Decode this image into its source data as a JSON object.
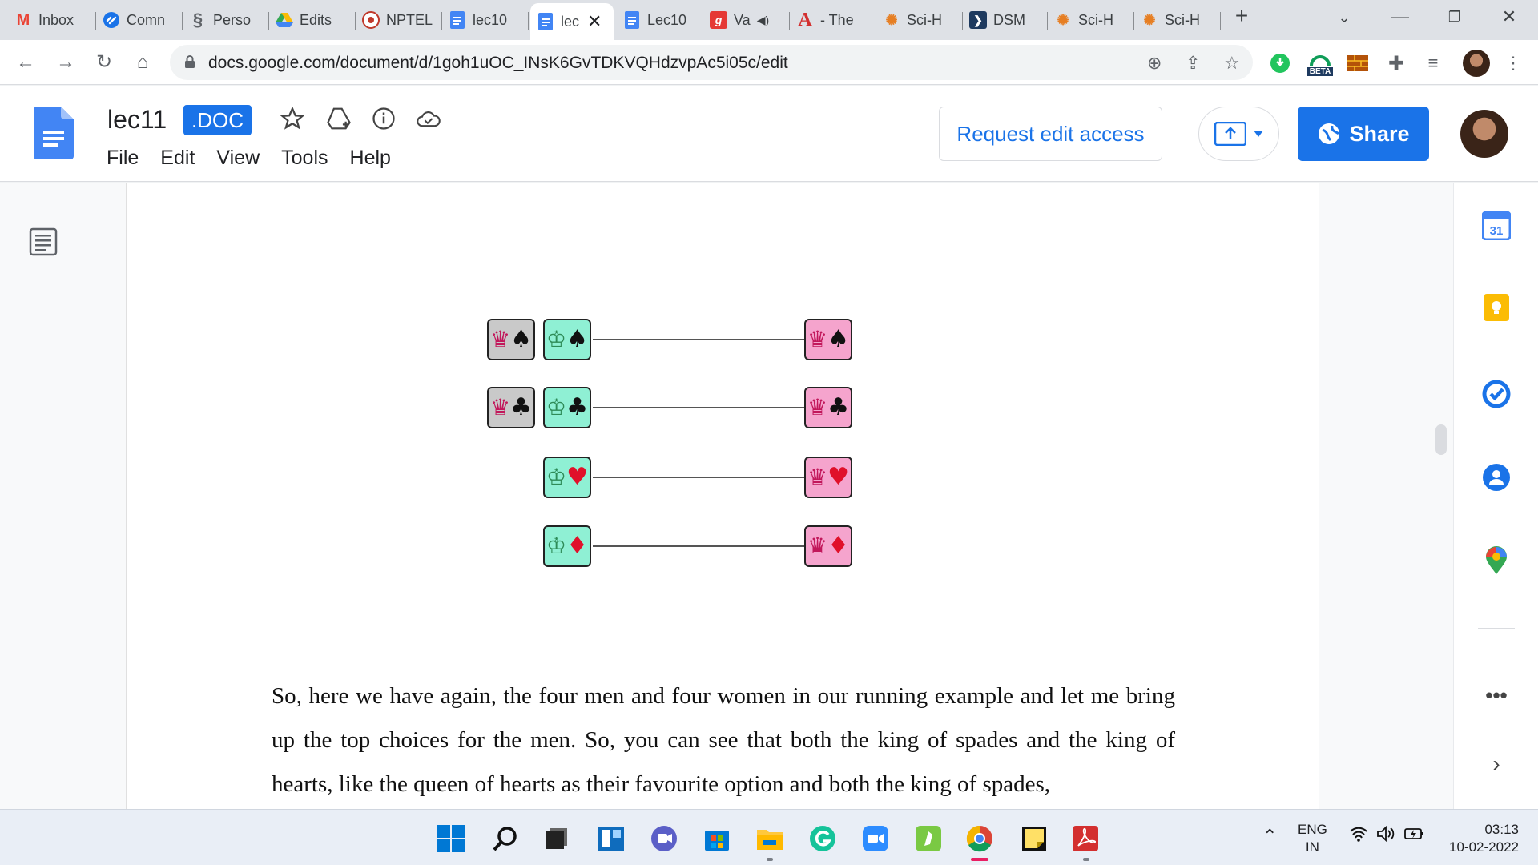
{
  "browser": {
    "tabs": [
      {
        "label": "Inbox",
        "icon": "gmail-icon",
        "color": "#ea4335"
      },
      {
        "label": "Comn",
        "icon": "link-icon",
        "color": "#1a73e8"
      },
      {
        "label": "Perso",
        "icon": "dna-icon",
        "color": "#5f6368"
      },
      {
        "label": "Edits",
        "icon": "drive-icon",
        "color": "#fbbc04"
      },
      {
        "label": "NPTEL",
        "icon": "nptel-icon",
        "color": "#c0392b"
      },
      {
        "label": "lec10",
        "icon": "docs-icon",
        "color": "#4285f4"
      },
      {
        "label": "lec",
        "icon": "docs-icon",
        "color": "#4285f4"
      },
      {
        "label": "Lec10",
        "icon": "docs-icon",
        "color": "#4285f4"
      },
      {
        "label": "Va",
        "icon": "g-icon",
        "color": "#e53935"
      },
      {
        "label": "- The",
        "icon": "acrobat-icon",
        "color": "#d32f2f"
      },
      {
        "label": "Sci-H",
        "icon": "scihub-icon",
        "color": "#e67e22"
      },
      {
        "label": "DSM",
        "icon": "arrow-icon",
        "color": "#1e3a5f"
      },
      {
        "label": "Sci-H",
        "icon": "scihub-icon",
        "color": "#e67e22"
      },
      {
        "label": "Sci-H",
        "icon": "scihub-icon",
        "color": "#e67e22"
      }
    ],
    "url": "docs.google.com/document/d/1goh1uOC_INsK6GvTDKVQHdzvpAc5i05c/edit",
    "beta_label": "BETA"
  },
  "doc": {
    "title": "lec11",
    "badge": ".DOC",
    "menu": [
      "File",
      "Edit",
      "View",
      "Tools",
      "Help"
    ],
    "request_edit": "Request edit access",
    "share": "Share"
  },
  "diagram": {
    "rows": [
      {
        "left_queen": "♠",
        "king": "♠",
        "right_queen": "♠",
        "suit_color": "black"
      },
      {
        "left_queen": "♣",
        "king": "♣",
        "right_queen": "♣",
        "suit_color": "black"
      },
      {
        "left_queen": "",
        "king": "♥",
        "right_queen": "♥",
        "suit_color": "red"
      },
      {
        "left_queen": "",
        "king": "♦",
        "right_queen": "♦",
        "suit_color": "red"
      }
    ],
    "queen_glyph": "♛",
    "king_glyph": "♔"
  },
  "body_text": "So, here we have again, the four men and four women in our running example and let me bring up the top choices for the men. So, you can see that both the king of spades and the king of hearts, like the queen of hearts as their favourite option and both the king of spades,",
  "side_panel": {
    "calendar_day": "31"
  },
  "taskbar": {
    "lang_line1": "ENG",
    "lang_line2": "IN",
    "time": "03:13",
    "date": "10-02-2022"
  },
  "colors": {
    "accent": "#1a73e8",
    "queen_card": "#f5a4cd",
    "king_card": "#8ff0d4",
    "queen_card_grey": "#c9c9c9"
  }
}
